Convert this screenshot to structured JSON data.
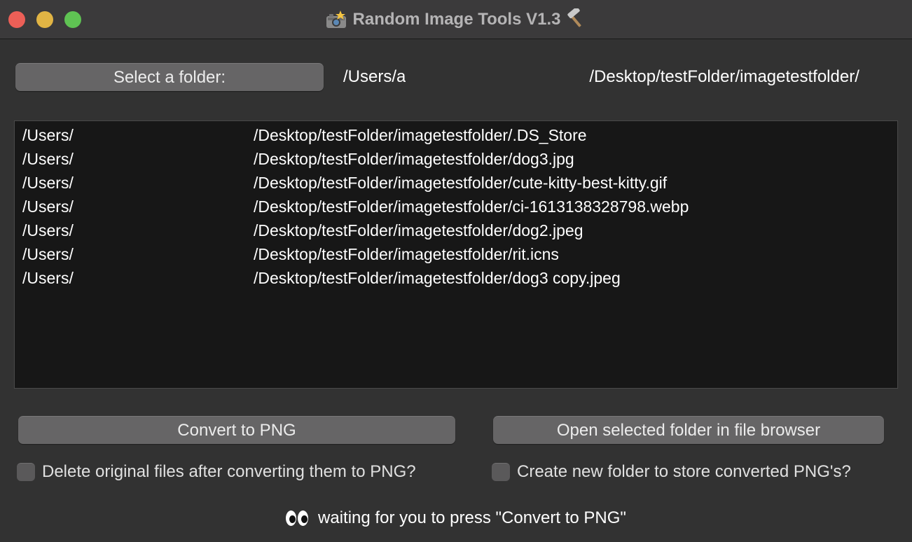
{
  "window": {
    "title": "Random Image Tools V1.3",
    "title_icon_left": "camera-flash-icon",
    "title_icon_right": "hammer-icon"
  },
  "folder": {
    "select_button_label": "Select a folder:",
    "path_start": "/Users/a",
    "path_end": "/Desktop/testFolder/imagetestfolder/"
  },
  "file_list": {
    "items": [
      {
        "prefix": "/Users/",
        "suffix": "/Desktop/testFolder/imagetestfolder/.DS_Store"
      },
      {
        "prefix": "/Users/",
        "suffix": "/Desktop/testFolder/imagetestfolder/dog3.jpg"
      },
      {
        "prefix": "/Users/",
        "suffix": "/Desktop/testFolder/imagetestfolder/cute-kitty-best-kitty.gif"
      },
      {
        "prefix": "/Users/",
        "suffix": "/Desktop/testFolder/imagetestfolder/ci-1613138328798.webp"
      },
      {
        "prefix": "/Users/",
        "suffix": "/Desktop/testFolder/imagetestfolder/dog2.jpeg"
      },
      {
        "prefix": "/Users/",
        "suffix": "/Desktop/testFolder/imagetestfolder/rit.icns"
      },
      {
        "prefix": "/Users/",
        "suffix": "/Desktop/testFolder/imagetestfolder/dog3 copy.jpeg"
      }
    ]
  },
  "actions": {
    "convert_label": "Convert to PNG",
    "open_folder_label": "Open selected folder in file browser"
  },
  "options": {
    "delete_originals_label": "Delete original files after converting them to PNG?",
    "delete_originals_checked": false,
    "new_folder_label": "Create new folder to store converted PNG's?",
    "new_folder_checked": false
  },
  "status": {
    "icon": "eyes-icon",
    "text": "waiting for you to press \"Convert to PNG\""
  },
  "colors": {
    "window_bg": "#323232",
    "button_bg": "#666566",
    "list_bg": "#171717",
    "close": "#ec5f57",
    "minimize": "#e1b444",
    "maximize": "#5fc353"
  }
}
